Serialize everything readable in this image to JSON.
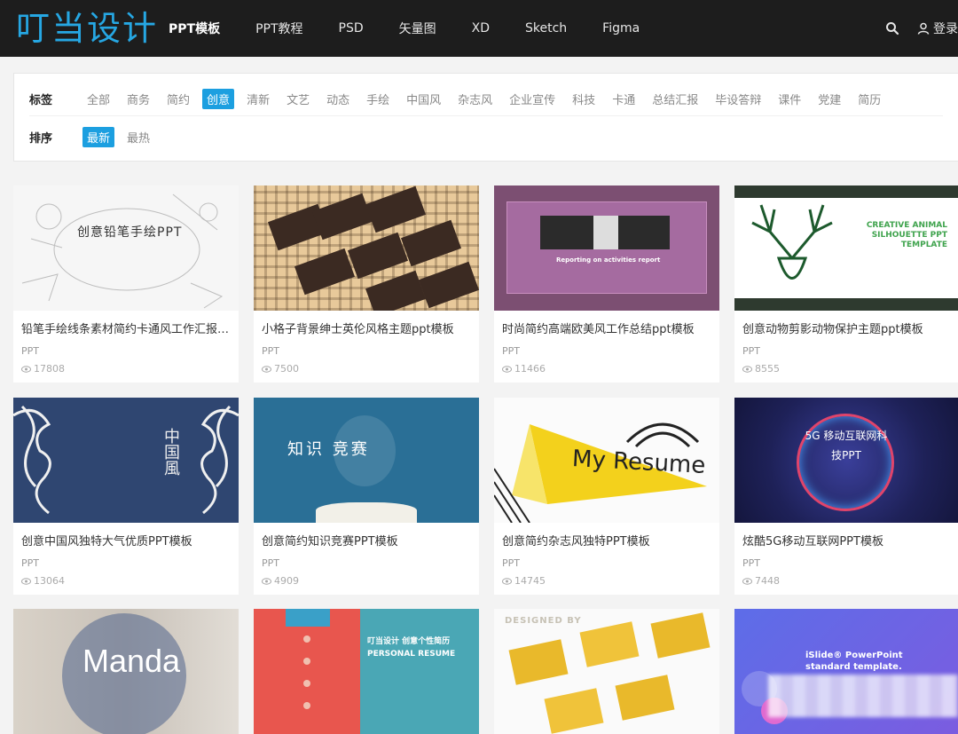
{
  "header": {
    "logo": "叮当设计",
    "nav": [
      "PPT模板",
      "PPT教程",
      "PSD",
      "矢量图",
      "XD",
      "Sketch",
      "Figma"
    ],
    "login": "登录"
  },
  "filters": {
    "tag_label": "标签",
    "tags": [
      "全部",
      "商务",
      "简约",
      "创意",
      "清新",
      "文艺",
      "动态",
      "手绘",
      "中国风",
      "杂志风",
      "企业宣传",
      "科技",
      "卡通",
      "总结汇报",
      "毕设答辩",
      "课件",
      "党建",
      "简历"
    ],
    "active_tag": "创意",
    "sort_label": "排序",
    "sorts": [
      "最新",
      "最热"
    ],
    "active_sort": "最新"
  },
  "cards": [
    {
      "title": "铅笔手绘线条素材简约卡通风工作汇报PPT模板",
      "category": "PPT",
      "views": "17808",
      "thumb_text": "创意铅笔手绘PPT"
    },
    {
      "title": "小格子背景绅士英伦风格主题ppt模板",
      "category": "PPT",
      "views": "7500"
    },
    {
      "title": "时尚简约高端欧美风工作总结ppt模板",
      "category": "PPT",
      "views": "11466",
      "thumb_text": "Reporting on activities report"
    },
    {
      "title": "创意动物剪影动物保护主题ppt模板",
      "category": "PPT",
      "views": "8555",
      "thumb_text": "CREATIVE ANIMAL SILHOUETTE PPT TEMPLATE"
    },
    {
      "title": "创意中国风独特大气优质PPT模板",
      "category": "PPT",
      "views": "13064",
      "thumb_text": "中国風"
    },
    {
      "title": "创意简约知识竞赛PPT模板",
      "category": "PPT",
      "views": "4909",
      "thumb_text": "知识   竞赛"
    },
    {
      "title": "创意简约杂志风独特PPT模板",
      "category": "PPT",
      "views": "14745",
      "thumb_text": "My Resume"
    },
    {
      "title": "炫酷5G移动互联网PPT模板",
      "category": "PPT",
      "views": "7448",
      "thumb_text": "5G 移动互联网科技PPT"
    },
    {
      "thumb_text": "Manda"
    },
    {
      "thumb_text": "叮当设计 创意个性简历 PERSONAL RESUME"
    },
    {
      "thumb_text": "DESIGNED BY"
    },
    {
      "thumb_text": "iSlide® PowerPoint standard template."
    }
  ],
  "colors": {
    "accent": "#1c9fe0",
    "header_bg": "#1d1d1d",
    "logo": "#26a7e3"
  }
}
